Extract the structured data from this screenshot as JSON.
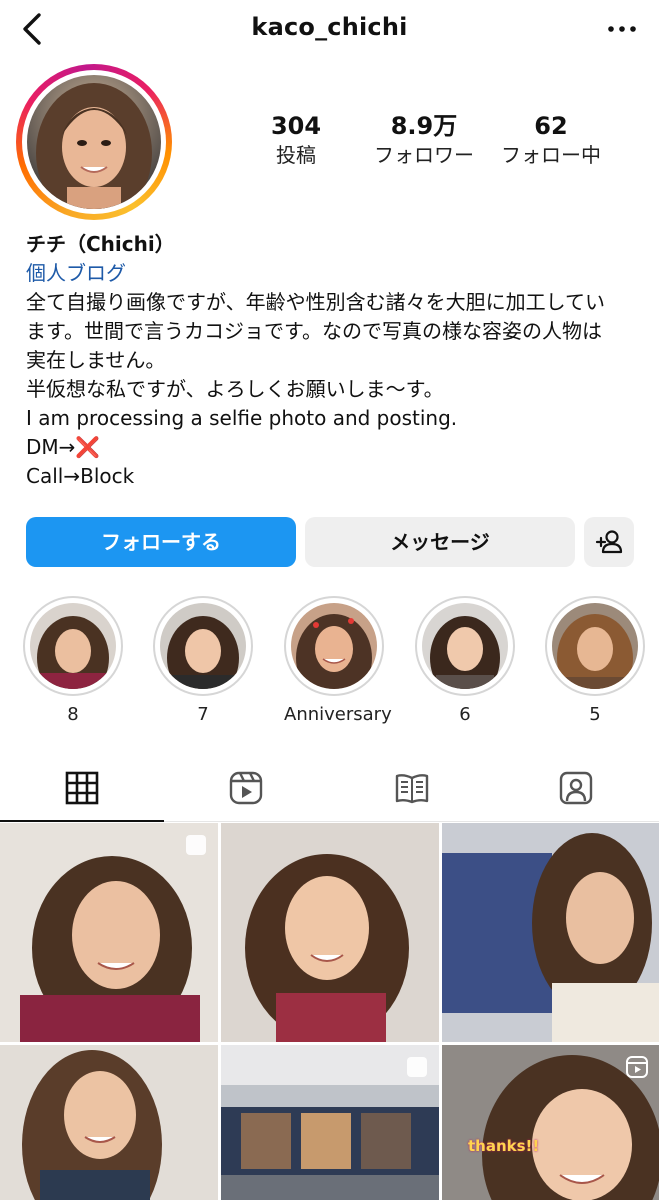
{
  "header": {
    "username": "kaco_chichi",
    "back_icon": "chevron-left-icon",
    "more_icon": "more-horizontal-icon"
  },
  "stats": [
    {
      "value": "304",
      "label": "投稿"
    },
    {
      "value": "8.9万",
      "label": "フォロワー"
    },
    {
      "value": "62",
      "label": "フォロー中"
    }
  ],
  "bio": {
    "display_name": "チチ（Chichi）",
    "category": "個人ブログ",
    "lines": [
      "全て自撮り画像ですが、年齢や性別含む諸々を大胆に加工してい",
      "ます。世間で言うカコジョです。なので写真の様な容姿の人物は",
      "実在しません。",
      "半仮想な私ですが、よろしくお願いしま〜す。",
      "I am processing a selfie photo and posting.",
      "DM→❌",
      "Call→Block"
    ]
  },
  "buttons": {
    "follow": "フォローする",
    "message": "メッセージ",
    "add_user_icon": "add-person-icon"
  },
  "highlights": [
    {
      "label": "8"
    },
    {
      "label": "7"
    },
    {
      "label": "Anniversary"
    },
    {
      "label": "6"
    },
    {
      "label": "5"
    }
  ],
  "tabs": [
    {
      "icon": "grid-icon",
      "active": true
    },
    {
      "icon": "reels-icon",
      "active": false
    },
    {
      "icon": "guide-icon",
      "active": false
    },
    {
      "icon": "tagged-icon",
      "active": false
    }
  ],
  "grid_overlay": {
    "thanks_text": "thanks!!"
  },
  "colors": {
    "accent": "#1c96f2",
    "link": "#1e5aa8",
    "button_secondary": "#efefef"
  }
}
